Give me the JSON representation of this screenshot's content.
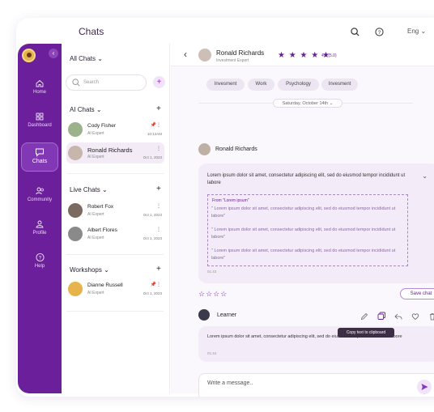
{
  "topbar": {
    "title": "Chats",
    "language": "Eng"
  },
  "sidebar": {
    "items": [
      {
        "label": "Home"
      },
      {
        "label": "Dashboard"
      },
      {
        "label": "Chats"
      },
      {
        "label": "Community"
      },
      {
        "label": "Profile"
      },
      {
        "label": "Help"
      }
    ]
  },
  "chatlist": {
    "filter": "All Chats",
    "search_placeholder": "Search",
    "sections": [
      {
        "title": "AI Chats",
        "items": [
          {
            "name": "Cody Fisher",
            "role": "AI Expert",
            "date": "10:12AM"
          },
          {
            "name": "Ronald Richards",
            "role": "AI Expert",
            "date": "Oct 1, 2023"
          }
        ]
      },
      {
        "title": "Live Chats",
        "items": [
          {
            "name": "Robert Fox",
            "role": "AI Expert",
            "date": "Oct 1, 2023"
          },
          {
            "name": "Albert Flores",
            "role": "AI Expert",
            "date": "Oct 1, 2023"
          }
        ]
      },
      {
        "title": "Workshops",
        "items": [
          {
            "name": "Dianne Russell",
            "role": "AI Expert",
            "date": "Oct 1, 2023"
          }
        ]
      }
    ]
  },
  "chat": {
    "header": {
      "name": "Ronald Richards",
      "role": "Investment Expert",
      "stars": "★ ★ ★ ★ ★",
      "rating": "4.8 (5.0)"
    },
    "chips": [
      "Invesment",
      "Work",
      "Psychology",
      "Invesment"
    ],
    "date_label": "Saturday, October 14th",
    "bot_name": "Ronald Richards",
    "bot_message": "Lorem ipsum dolor sit amet, consectetur adipiscing elit, sed do eiusmod tempor incididunt ut labore",
    "quote_from": "From \"Lorem ipsum\"",
    "quotes": [
      "\" Lorem ipsum dolor sit amet, consectetur adipiscing elit, sed do eiusmod tempor incididunt ut labore\"",
      "\" Lorem ipsum dolor sit amet, consectetur adipiscing elit, sed do eiusmod tempor incididunt ut labore\"",
      "\" Lorem ipsum dolor sit amet, consectetur adipiscing elit, sed do eiusmod tempor incididunt ut labore\""
    ],
    "bot_time": "01:43",
    "rating_stars": "☆☆☆☆",
    "save_label": "Save chat",
    "user_name": "Learner",
    "tooltip": "Copy text to clipboard",
    "user_message": "Lorem ipsum dolor sit amet, consectetur adipiscing elit, sed do eiusmod tempor incididunt ut labore",
    "user_time": "01:44",
    "composer_placeholder": "Write a message.."
  },
  "colors": {
    "accent": "#6b1f9a",
    "bubble": "#f3ebf8"
  }
}
